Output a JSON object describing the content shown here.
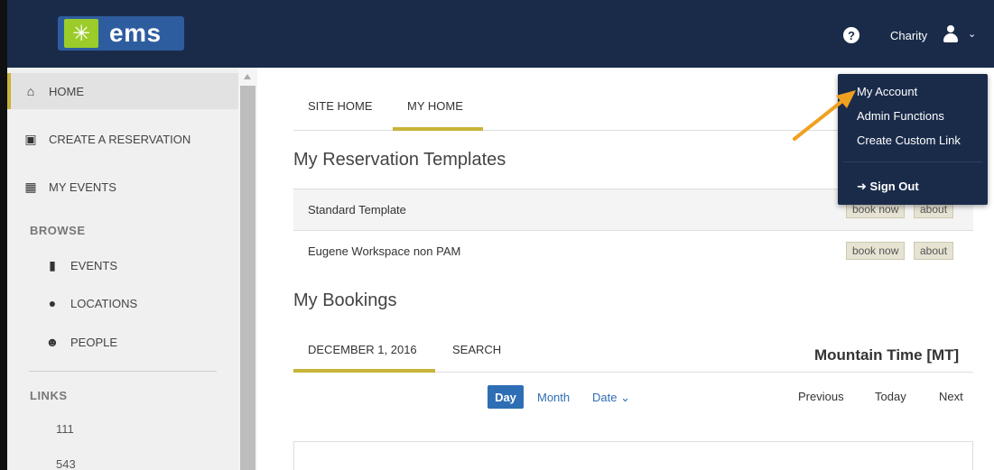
{
  "header": {
    "logo_text": "ems",
    "user_name": "Charity",
    "help_icon": "question-circle-icon",
    "user_icon": "user-icon",
    "caret_icon": "chevron-down-icon"
  },
  "user_menu": {
    "items": [
      "My Account",
      "Admin Functions",
      "Create Custom Link"
    ],
    "sign_out": "Sign Out"
  },
  "sidebar": {
    "items": [
      {
        "label": "HOME",
        "icon": "home-icon"
      },
      {
        "label": "CREATE A RESERVATION",
        "icon": "calendar-plus-icon"
      },
      {
        "label": "MY EVENTS",
        "icon": "grid-icon"
      }
    ],
    "browse_heading": "BROWSE",
    "browse_items": [
      {
        "label": "EVENTS",
        "icon": "bookmark-icon"
      },
      {
        "label": "LOCATIONS",
        "icon": "map-pin-icon"
      },
      {
        "label": "PEOPLE",
        "icon": "users-icon"
      }
    ],
    "links_heading": "LINKS",
    "links": [
      "111",
      "543"
    ]
  },
  "main": {
    "tabs": [
      "SITE HOME",
      "MY HOME"
    ],
    "templates_title": "My Reservation Templates",
    "templates": [
      {
        "name": "Standard Template",
        "book": "book now",
        "about": "about"
      },
      {
        "name": "Eugene Workspace non PAM",
        "book": "book now",
        "about": "about"
      }
    ],
    "bookings_title": "My Bookings",
    "booking_tabs": [
      "DECEMBER 1, 2016",
      "SEARCH"
    ],
    "timezone": "Mountain Time [MT]",
    "view_day": "Day",
    "view_month": "Month",
    "view_date": "Date",
    "nav_previous": "Previous",
    "nav_today": "Today",
    "nav_next": "Next"
  },
  "colors": {
    "header_bg": "#1a2b4a",
    "accent_gold": "#c9b43a",
    "link_blue": "#2e6eb5",
    "arrow_orange": "#f0a020"
  }
}
